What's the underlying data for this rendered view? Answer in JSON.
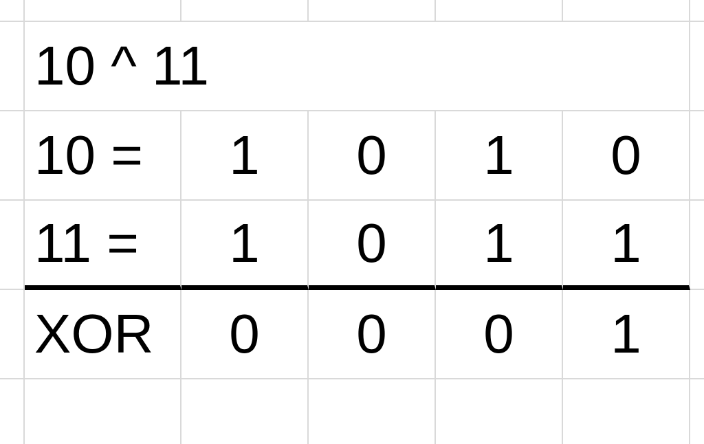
{
  "title": "10 ^ 11",
  "rows": [
    {
      "label": "10 =",
      "bits": [
        "1",
        "0",
        "1",
        "0"
      ]
    },
    {
      "label": "11 =",
      "bits": [
        "1",
        "0",
        "1",
        "1"
      ]
    },
    {
      "label": "XOR",
      "bits": [
        "0",
        "0",
        "0",
        "1"
      ]
    }
  ]
}
